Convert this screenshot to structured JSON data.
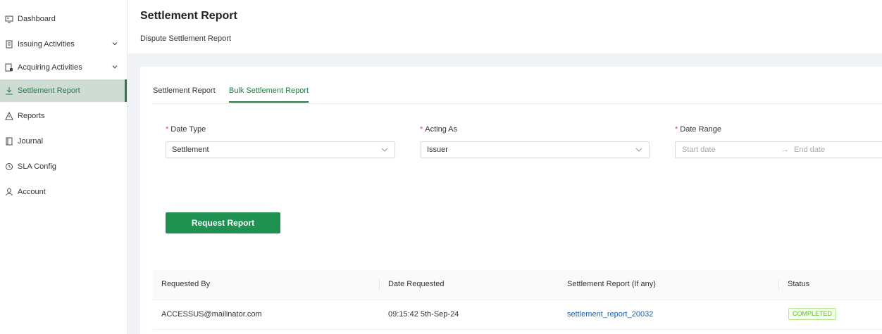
{
  "sidebar": {
    "items": [
      {
        "label": "Dashboard",
        "icon": "dashboard-icon"
      },
      {
        "label": "Issuing Activities",
        "icon": "issuing-icon",
        "expandable": true
      },
      {
        "label": "Acquiring Activities",
        "icon": "acquiring-icon",
        "expandable": true
      },
      {
        "label": "Settlement Report",
        "icon": "download-icon",
        "active": true
      },
      {
        "label": "Reports",
        "icon": "warning-icon"
      },
      {
        "label": "Journal",
        "icon": "journal-icon"
      },
      {
        "label": "SLA Config",
        "icon": "clock-icon"
      },
      {
        "label": "Account",
        "icon": "user-icon"
      }
    ]
  },
  "header": {
    "title": "Settlement Report",
    "subtitle": "Dispute Settlement Report"
  },
  "tabs": [
    {
      "label": "Settlement Report",
      "active": false
    },
    {
      "label": "Bulk Settlement Report",
      "active": true
    }
  ],
  "form": {
    "date_type": {
      "label": "Date Type",
      "value": "Settlement"
    },
    "acting_as": {
      "label": "Acting As",
      "value": "Issuer"
    },
    "date_range": {
      "label": "Date Range",
      "start_placeholder": "Start date",
      "end_placeholder": "End date",
      "separator": "→"
    },
    "required_mark": "*",
    "submit_label": "Request Report"
  },
  "table": {
    "columns": [
      "Requested By",
      "Date Requested",
      "Settlement Report (If any)",
      "Status"
    ],
    "rows": [
      {
        "requested_by": "ACCESSUS@mailinator.com",
        "date_requested": "09:15:42 5th-Sep-24",
        "report": "settlement_report_20032",
        "status": "COMPLETED"
      }
    ]
  },
  "colors": {
    "accent": "#1f9151",
    "active_nav_bg": "#cfdcd4",
    "link": "#1a5fb4",
    "status_completed": "#52c41a"
  }
}
